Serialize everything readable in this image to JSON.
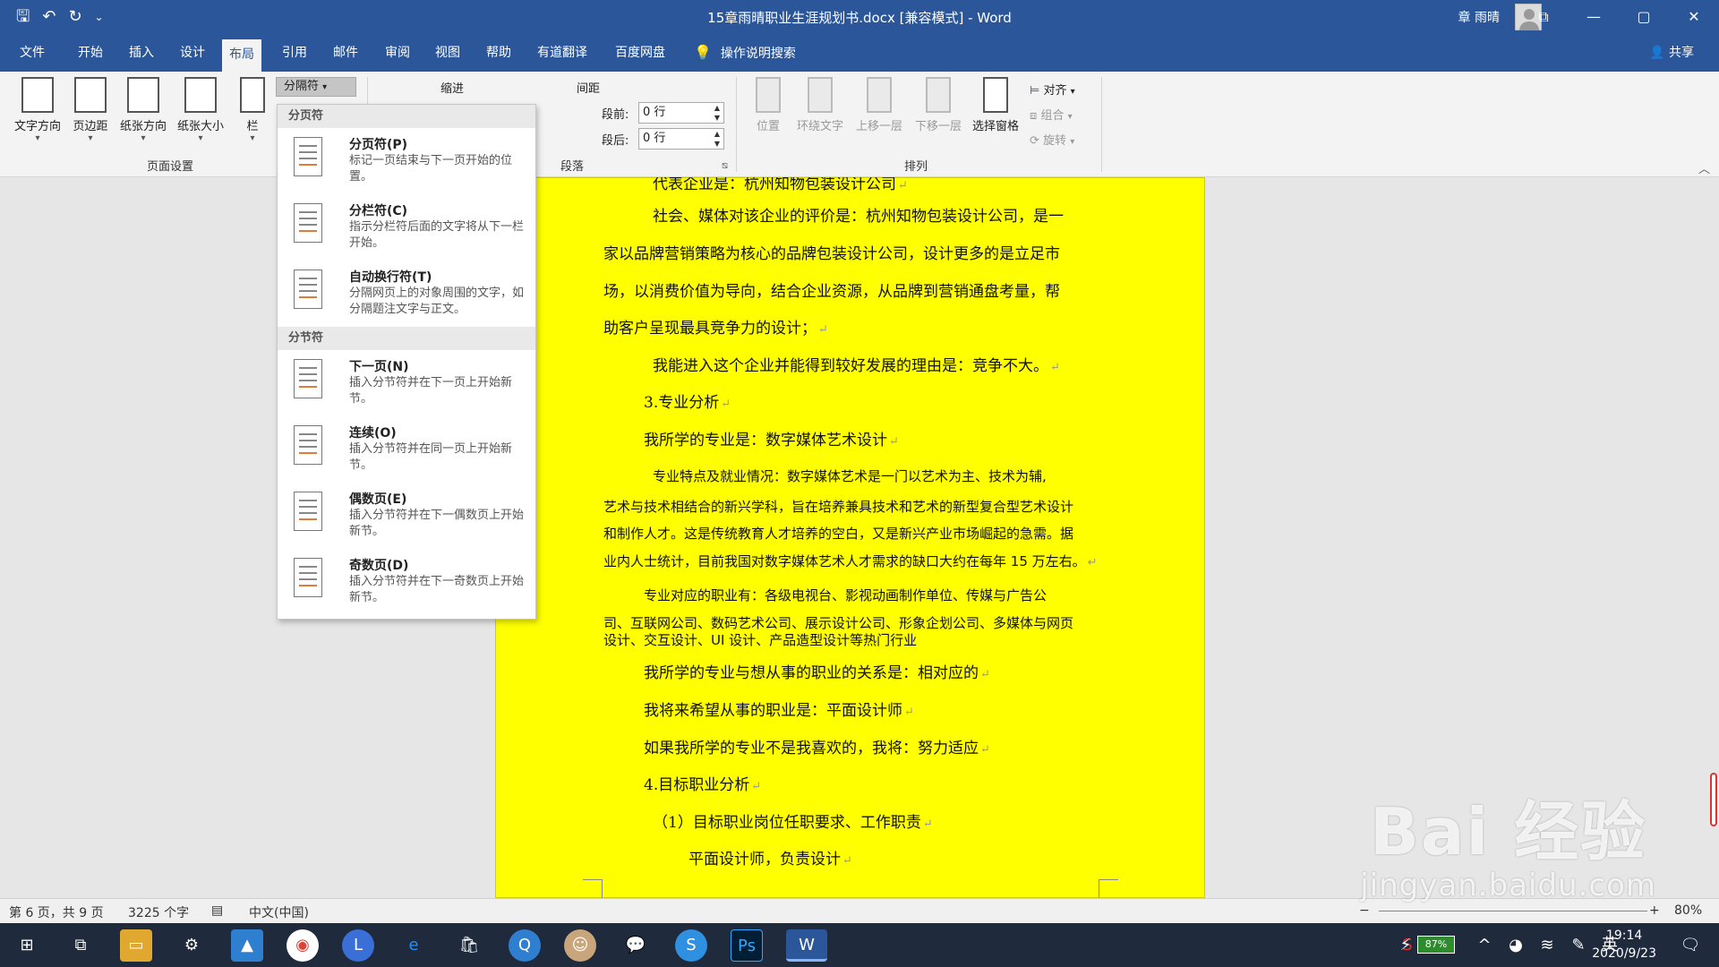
{
  "window": {
    "title": "15章雨晴职业生涯规划书.docx [兼容模式] - Word",
    "user": "章 雨晴",
    "qat_save": "🖫",
    "qat_undo": "↶",
    "qat_redo": "↻",
    "qat_more": "⌄",
    "min": "—",
    "max": "▢",
    "close": "✕",
    "ribbon_display": "⧉"
  },
  "tabs": [
    "文件",
    "开始",
    "插入",
    "设计",
    "布局",
    "引用",
    "邮件",
    "审阅",
    "视图",
    "帮助",
    "有道翻译",
    "百度网盘"
  ],
  "active_tab": "布局",
  "search_label": "操作说明搜索",
  "share_label": "共享",
  "ribbon": {
    "page_setup": {
      "buttons": [
        "文字方向",
        "页边距",
        "纸张方向",
        "纸张大小",
        "栏"
      ],
      "group_label": "页面设置",
      "breaks_button": "分隔符"
    },
    "paragraph": {
      "indent_label": "缩进",
      "spacing_label": "间距",
      "before_label": "段前:",
      "before_value": "0 行",
      "after_label": "段后:",
      "after_value": "0 行",
      "group_label": "段落"
    },
    "arrange": {
      "buttons": [
        "位置",
        "环绕文字",
        "上移一层",
        "下移一层",
        "选择窗格"
      ],
      "align": "对齐",
      "group": "组合",
      "rotate": "旋转",
      "group_label": "排列"
    }
  },
  "breaks_menu": {
    "page_breaks_header": "分页符",
    "section_breaks_header": "分节符",
    "items": [
      {
        "title": "分页符(P)",
        "desc": "标记一页结束与下一页开始的位置。"
      },
      {
        "title": "分栏符(C)",
        "desc": "指示分栏符后面的文字将从下一栏开始。"
      },
      {
        "title": "自动换行符(T)",
        "desc": "分隔网页上的对象周围的文字，如分隔题注文字与正文。"
      },
      {
        "title": "下一页(N)",
        "desc": "插入分节符并在下一页上开始新节。"
      },
      {
        "title": "连续(O)",
        "desc": "插入分节符并在同一页上开始新节。"
      },
      {
        "title": "偶数页(E)",
        "desc": "插入分节符并在下一偶数页上开始新节。"
      },
      {
        "title": "奇数页(D)",
        "desc": "插入分节符并在下一奇数页上开始新节。"
      }
    ]
  },
  "document": {
    "paragraphs": [
      "代表企业是：杭州知物包装设计公司",
      "社会、媒体对该企业的评价是：杭州知物包装设计公司，是一",
      "家以品牌营销策略为核心的品牌包装设计公司，设计更多的是立足市",
      "场，以消费价值为导向，结合企业资源，从品牌到营销通盘考量，帮",
      "助客户呈现最具竞争力的设计；",
      "我能进入这个企业并能得到较好发展的理由是：竞争不大。",
      "3.专业分析",
      "我所学的专业是：数字媒体艺术设计",
      "专业特点及就业情况：数字媒体艺术是一门以艺术为主、技术为辅,",
      "艺术与技术相结合的新兴学科，旨在培养兼具技术和艺术的新型复合型艺术设计",
      "和制作人才。这是传统教育人才培养的空白，又是新兴产业市场崛起的急需。据",
      "业内人士统计，目前我国对数字媒体艺术人才需求的缺口大约在每年 15 万左右。",
      "专业对应的职业有：各级电视台、影视动画制作单位、传媒与广告公",
      "司、互联网公司、数码艺术公司、展示设计公司、形象企划公司、多媒体与网页",
      "设计、交互设计、UI 设计、产品造型设计等热门行业",
      "我所学的专业与想从事的职业的关系是：相对应的",
      "我将来希望从事的职业是：平面设计师",
      "如果我所学的专业不是我喜欢的，我将：努力适应",
      "4.目标职业分析",
      "（1）目标职业岗位任职要求、工作职责",
      "平面设计师，负责设计"
    ],
    "para_mark": "↵"
  },
  "status": {
    "page": "第 6 页，共 9 页",
    "words": "3225 个字",
    "language": "中文(中国)",
    "zoom": "80%",
    "zoom_minus": "−",
    "zoom_plus": "+"
  },
  "taskbar": {
    "time": "19:14",
    "date": "2020/9/23",
    "battery": "87%"
  },
  "watermark": {
    "main": "Bai 经验",
    "sub": "jingyan.baidu.com"
  }
}
